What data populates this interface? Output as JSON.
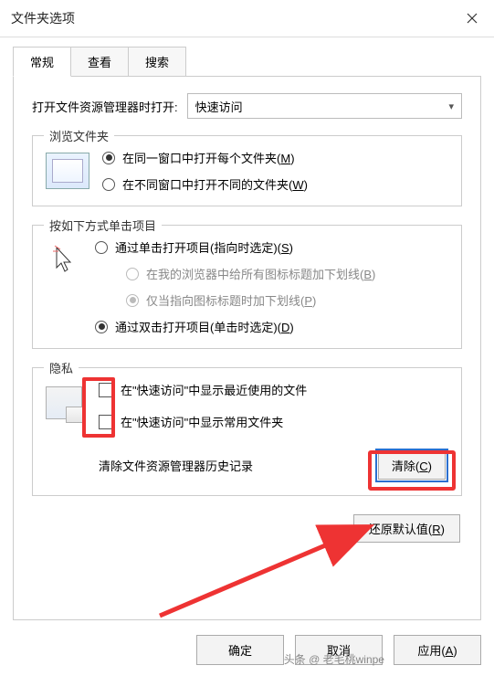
{
  "titlebar": {
    "title": "文件夹选项"
  },
  "tabs": {
    "general": "常规",
    "view": "查看",
    "search": "搜索"
  },
  "open_in": {
    "label": "打开文件资源管理器时打开:",
    "value": "快速访问"
  },
  "browse": {
    "legend": "浏览文件夹",
    "same_window": "在同一窗口中打开每个文件夹(",
    "same_window_key": "M",
    "new_window": "在不同窗口中打开不同的文件夹(",
    "new_window_key": "W"
  },
  "click": {
    "legend": "按如下方式单击项目",
    "single": "通过单击打开项目(指向时选定)(",
    "single_key": "S",
    "underline_all": "在我的浏览器中给所有图标标题加下划线(",
    "underline_all_key": "B",
    "underline_point": "仅当指向图标标题时加下划线(",
    "underline_point_key": "P",
    "double": "通过双击打开项目(单击时选定)(",
    "double_key": "D"
  },
  "privacy": {
    "legend": "隐私",
    "recent_files": "在\"快速访问\"中显示最近使用的文件",
    "frequent_folders": "在\"快速访问\"中显示常用文件夹",
    "clear_label": "清除文件资源管理器历史记录",
    "clear_btn": "清除(",
    "clear_btn_key": "C"
  },
  "restore": {
    "label": "还原默认值(",
    "key": "R"
  },
  "buttons": {
    "ok": "确定",
    "cancel": "取消",
    "apply": "应用(",
    "apply_key": "A"
  },
  "watermark": "头条 @ 老毛桃winpe"
}
